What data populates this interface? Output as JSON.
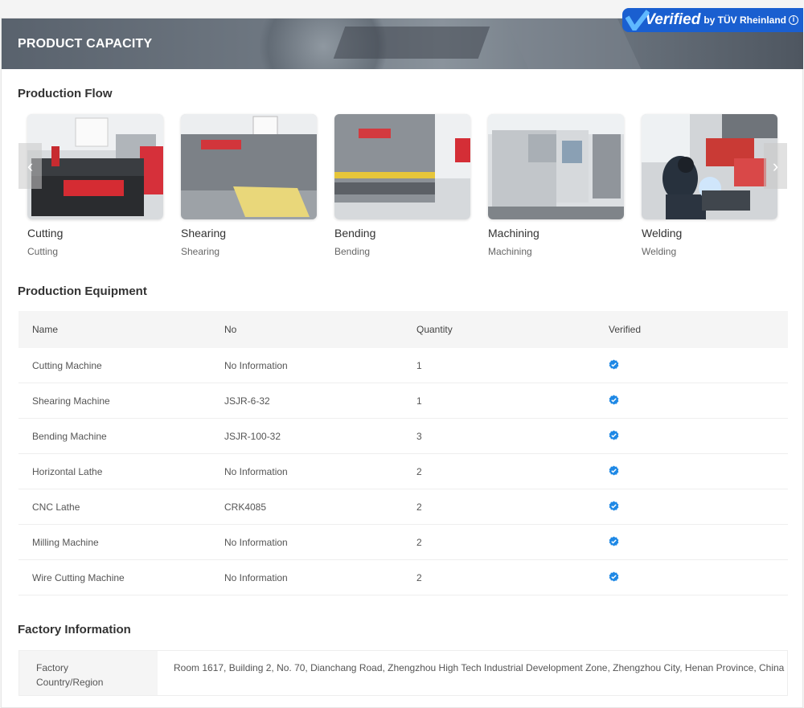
{
  "banner": {
    "title": "PRODUCT CAPACITY"
  },
  "verified_badge": {
    "word": "Verified",
    "by": "by TÜV Rheinland",
    "info": "i"
  },
  "production_flow": {
    "title": "Production Flow",
    "items": [
      {
        "name": "Cutting",
        "sub": "Cutting"
      },
      {
        "name": "Shearing",
        "sub": "Shearing"
      },
      {
        "name": "Bending",
        "sub": "Bending"
      },
      {
        "name": "Machining",
        "sub": "Machining"
      },
      {
        "name": "Welding",
        "sub": "Welding"
      }
    ],
    "prev": "‹",
    "next": "›"
  },
  "equipment": {
    "title": "Production Equipment",
    "headers": [
      "Name",
      "No",
      "Quantity",
      "Verified"
    ],
    "rows": [
      {
        "name": "Cutting Machine",
        "no": "No Information",
        "qty": "1"
      },
      {
        "name": "Shearing Machine",
        "no": "JSJR-6-32",
        "qty": "1"
      },
      {
        "name": "Bending Machine",
        "no": "JSJR-100-32",
        "qty": "3"
      },
      {
        "name": "Horizontal Lathe",
        "no": "No Information",
        "qty": "2"
      },
      {
        "name": "CNC Lathe",
        "no": "CRK4085",
        "qty": "2"
      },
      {
        "name": "Milling Machine",
        "no": "No Information",
        "qty": "2"
      },
      {
        "name": "Wire Cutting Machine",
        "no": "No Information",
        "qty": "2"
      }
    ]
  },
  "factory": {
    "title": "Factory Information",
    "label_line1": "Factory",
    "label_line2": "Country/Region",
    "value": "Room 1617, Building 2, No. 70, Dianchang Road, Zhengzhou High Tech Industrial Development Zone, Zhengzhou City, Henan Province, China"
  },
  "colors": {
    "accent": "#1a5fd0",
    "verified_icon": "#1e88e5"
  }
}
